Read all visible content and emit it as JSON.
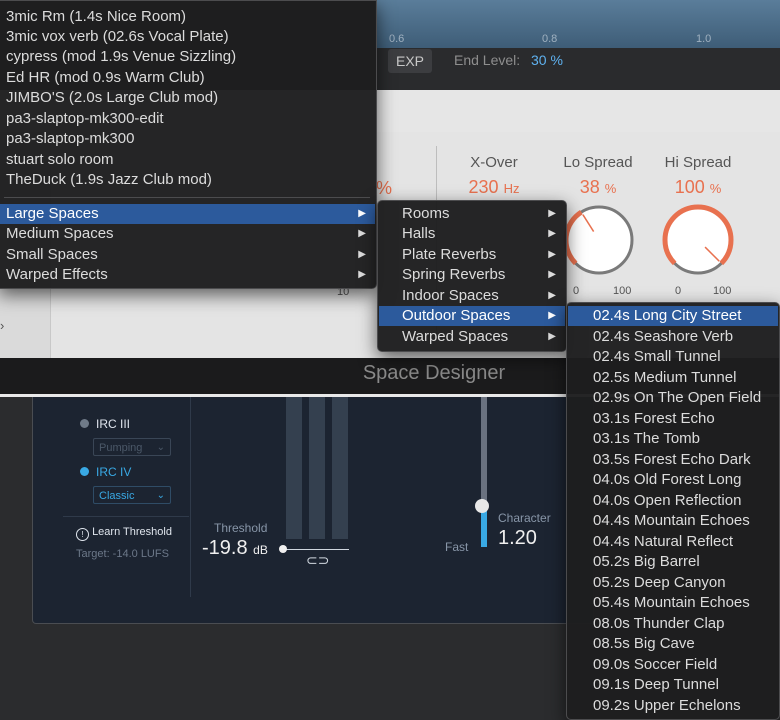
{
  "graph": {
    "tick_labels": [
      "0.6",
      "0.8",
      "1.0"
    ],
    "exp_label": "EXP",
    "end_level_label": "End Level:",
    "end_level_value": "30 %"
  },
  "params": [
    {
      "title": "X-Over",
      "value": "230",
      "unit": "Hz"
    },
    {
      "title": "Lo Spread",
      "value": "38",
      "unit": "%",
      "level": 0.38,
      "min": "0",
      "max": "100"
    },
    {
      "title": "Hi Spread",
      "value": "100",
      "unit": "%",
      "level": 1.0,
      "min": "0",
      "max": "100"
    }
  ],
  "partial_left": {
    "pct": "%",
    "scale": "10"
  },
  "plugin_title": "Space Designer",
  "loudness": {
    "irc3_label": "IRC III",
    "irc3_mode": "Pumping",
    "irc4_label": "IRC IV",
    "irc4_mode": "Classic",
    "learn_label": "Learn Threshold",
    "target": "Target: -14.0 LUFS",
    "threshold_label": "Threshold",
    "threshold_value": "-19.8",
    "threshold_unit": "dB",
    "fast_label": "Fast",
    "character_label": "Character",
    "character_value": "1.20"
  },
  "menu1": {
    "presets": [
      "3mic Rm (1.4s Nice Room)",
      "3mic vox verb (02.6s Vocal Plate)",
      "cypress (mod 1.9s Venue Sizzling)",
      "Ed HR (mod 0.9s Warm Club)",
      "JIMBO'S (2.0s Large Club mod)",
      "pa3-slaptop-mk300-edit",
      "pa3-slaptop-mk300",
      "stuart solo room",
      "TheDuck (1.9s Jazz Club mod)"
    ],
    "categories": [
      "Large Spaces",
      "Medium Spaces",
      "Small Spaces",
      "Warped Effects"
    ],
    "selected_category": "Large Spaces"
  },
  "menu2": {
    "items": [
      "Rooms",
      "Halls",
      "Plate Reverbs",
      "Spring Reverbs",
      "Indoor Spaces",
      "Outdoor Spaces",
      "Warped Spaces"
    ],
    "selected": "Outdoor Spaces"
  },
  "menu3": {
    "items": [
      "02.4s Long City Street",
      "02.4s Seashore Verb",
      "02.4s Small Tunnel",
      "02.5s Medium Tunnel",
      "02.9s On The Open Field",
      "03.1s Forest Echo",
      "03.1s The Tomb",
      "03.5s Forest Echo Dark",
      "04.0s Old Forest Long",
      "04.0s Open Reflection",
      "04.4s Mountain Echoes",
      "04.4s Natural Reflect",
      "05.2s Big Barrel",
      "05.2s Deep Canyon",
      "05.4s Mountain Echoes",
      "08.0s Thunder Clap",
      "08.5s Big Cave",
      "09.0s Soccer Field",
      "09.1s Deep Tunnel",
      "09.2s Upper Echelons"
    ],
    "selected": "02.4s Long City Street"
  },
  "colors": {
    "accent_blue": "#39a9e4",
    "param_orange": "#e8714f",
    "menu_highlight": "#2c5a9c"
  },
  "icons": {
    "submenu": "chevron-right-icon",
    "link": "link-icon",
    "info": "info-icon"
  }
}
